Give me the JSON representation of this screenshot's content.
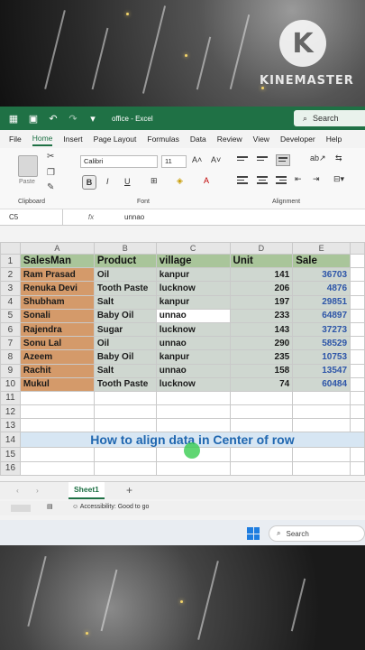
{
  "overlay": {
    "brand": "KINEMASTER",
    "brand_logo_letter": "K"
  },
  "excel": {
    "titlebar": {
      "doc_title": "office - Excel",
      "search_label": "Search"
    },
    "menu": [
      "File",
      "Home",
      "Insert",
      "Page Layout",
      "Formulas",
      "Data",
      "Review",
      "View",
      "Developer",
      "Help"
    ],
    "active_menu": "Home",
    "ribbon": {
      "paste_label": "Paste",
      "clipboard_label": "Clipboard",
      "font_label": "Font",
      "alignment_label": "Alignment",
      "font_name": "Calibri",
      "font_size": "11"
    },
    "formula_bar": {
      "name_box": "C5",
      "fx": "fx",
      "value": "unnao"
    },
    "columns": [
      "A",
      "B",
      "C",
      "D",
      "E"
    ],
    "headers": [
      "SalesMan",
      "Product",
      "village",
      "Unit",
      "Sale"
    ],
    "rows": [
      [
        "Ram Prasad",
        "Oil",
        "kanpur",
        "141",
        "36703"
      ],
      [
        "Renuka Devi",
        "Tooth Paste",
        "lucknow",
        "206",
        "4876"
      ],
      [
        "Shubham",
        "Salt",
        "kanpur",
        "197",
        "29851"
      ],
      [
        "Sonali",
        "Baby Oil",
        "unnao",
        "233",
        "64897"
      ],
      [
        "Rajendra",
        "Sugar",
        "lucknow",
        "143",
        "37273"
      ],
      [
        "Sonu Lal",
        "Oil",
        "unnao",
        "290",
        "58529"
      ],
      [
        "Azeem",
        "Baby Oil",
        "kanpur",
        "235",
        "10753"
      ],
      [
        "Rachit",
        "Salt",
        "unnao",
        "158",
        "13547"
      ],
      [
        "Mukul",
        "Tooth Paste",
        "lucknow",
        "74",
        "60484"
      ]
    ],
    "row_numbers": [
      "1",
      "2",
      "3",
      "4",
      "5",
      "6",
      "7",
      "8",
      "9",
      "10",
      "11",
      "12",
      "13",
      "14",
      "15",
      "16"
    ],
    "banner_text": "How to align data in Center of row",
    "sheet_tab": "Sheet1",
    "status": {
      "accessibility": "Accessibility: Good to go"
    },
    "taskbar": {
      "search_label": "Search"
    }
  }
}
